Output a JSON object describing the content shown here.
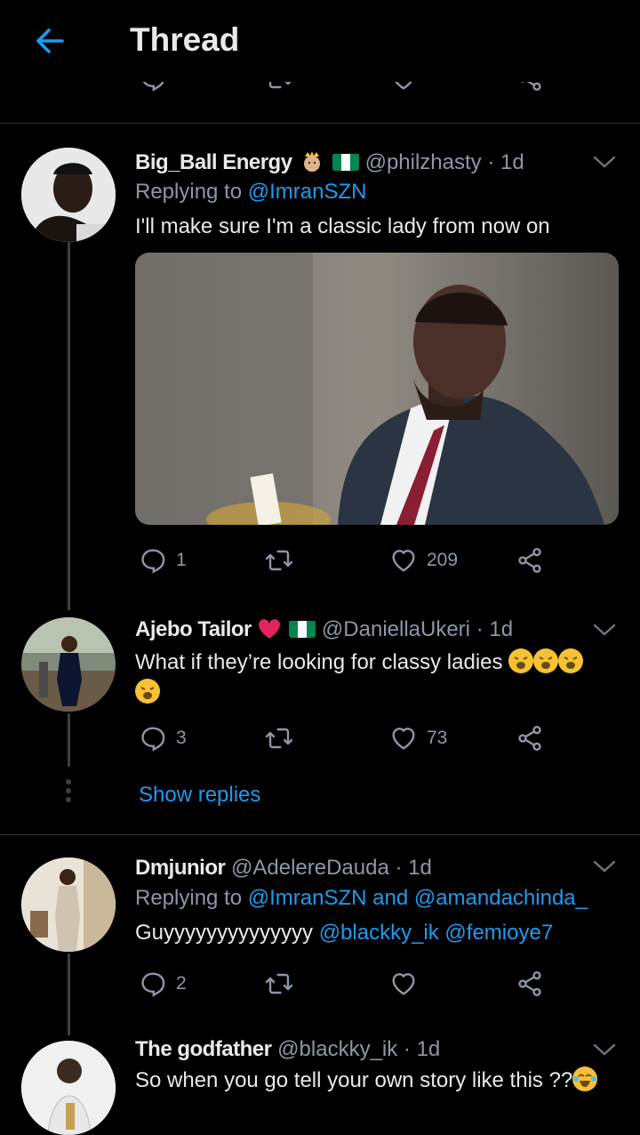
{
  "header": {
    "title": "Thread"
  },
  "tweets": [
    {
      "name": "Big_Ball Energy",
      "handle": "@philzhasty",
      "time": "· 1d",
      "replying_prefix": "Replying to",
      "replying_to": "@ImranSZN",
      "text": "I'll make sure I'm a classic lady from now on",
      "replies": "1",
      "likes": "209"
    },
    {
      "name": "Ajebo Tailor",
      "handle": "@DaniellaUkeri",
      "time": "· 1d",
      "text": "What if they’re looking for classy ladies",
      "replies": "3",
      "likes": "73",
      "show_replies": "Show replies"
    },
    {
      "name": "Dmjunior",
      "handle": "@AdelereDauda",
      "time": "· 1d",
      "replying_prefix": "Replying to",
      "replying_to": "@ImranSZN and @amandachinda_",
      "text_plain": "Guyyyyyyyyyyyyyy ",
      "mentions": "@blackky_ik @femioye7",
      "replies": "2"
    },
    {
      "name": "The godfather",
      "handle": "@blackky_ik",
      "time": "· 1d",
      "text": "So when you go tell your own story like this ??"
    }
  ],
  "colors": {
    "accent": "#1d9bf0",
    "muted": "#8b98a5",
    "like_red": "#e0245e",
    "flag_green": "#008751"
  },
  "icons": [
    "back-arrow-icon",
    "reply-icon",
    "retweet-icon",
    "like-icon",
    "share-icon",
    "chevron-down-icon",
    "emoji-weary-face",
    "emoji-crying-laughing",
    "emoji-prince",
    "heart-emoji",
    "nigeria-flag"
  ]
}
